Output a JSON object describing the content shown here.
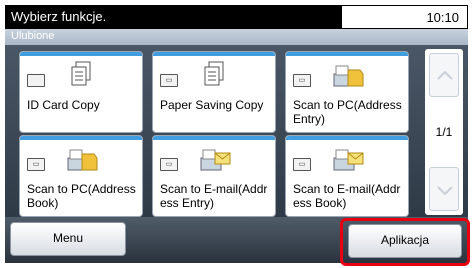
{
  "header": {
    "title": "Wybierz funkcje.",
    "clock": "10:10"
  },
  "subheader": {
    "label": "Ulubione"
  },
  "tiles": [
    {
      "label": "ID Card Copy",
      "mini_icon": "mode-icon",
      "icon": "document-stack-icon"
    },
    {
      "label": "Paper Saving Copy",
      "mini_icon": "mode-icon",
      "icon": "document-stack-icon"
    },
    {
      "label": "Scan to PC(Address Entry)",
      "mini_icon": "mode-icon",
      "icon": "scan-to-folder-icon"
    },
    {
      "label": "Scan to PC(Address Book)",
      "mini_icon": "mode-icon",
      "icon": "scan-to-folder-icon"
    },
    {
      "label": "Scan to E-mail(Address Entry)",
      "mini_icon": "mode-icon",
      "icon": "scan-to-email-icon"
    },
    {
      "label": "Scan to E-mail(Address Book)",
      "mini_icon": "mode-icon",
      "icon": "scan-to-email-icon"
    }
  ],
  "pager": {
    "page": "1/1"
  },
  "footer": {
    "menu_label": "Menu",
    "application_label": "Aplikacja"
  },
  "colors": {
    "accent_stripe": "#3f9de0",
    "highlight": "#e60012"
  }
}
